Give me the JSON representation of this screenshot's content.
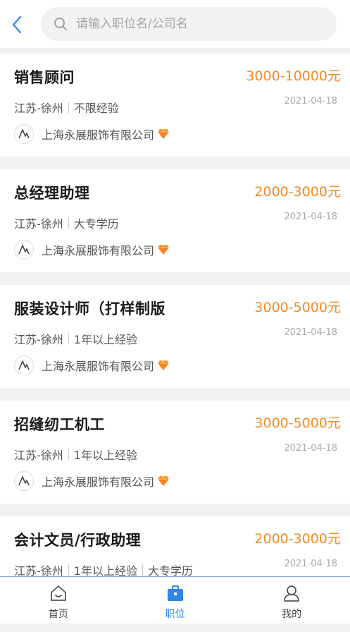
{
  "header": {
    "search_placeholder": "请输入职位名/公司名"
  },
  "jobs": [
    {
      "title": "销售顾问",
      "salary": "3000-10000元",
      "location": "江苏-徐州",
      "tags": [
        "不限经验"
      ],
      "date": "2021-04-18",
      "company": "上海永展服饰有限公司"
    },
    {
      "title": "总经理助理",
      "salary": "2000-3000元",
      "location": "江苏-徐州",
      "tags": [
        "大专学历"
      ],
      "date": "2021-04-18",
      "company": "上海永展服饰有限公司"
    },
    {
      "title": "服装设计师（打样制版",
      "salary": "3000-5000元",
      "location": "江苏-徐州",
      "tags": [
        "1年以上经验"
      ],
      "date": "2021-04-18",
      "company": "上海永展服饰有限公司"
    },
    {
      "title": "招缝纫工机工",
      "salary": "3000-5000元",
      "location": "江苏-徐州",
      "tags": [
        "1年以上经验"
      ],
      "date": "2021-04-18",
      "company": "上海永展服饰有限公司"
    },
    {
      "title": "会计文员/行政助理",
      "salary": "2000-3000元",
      "location": "江苏-徐州",
      "tags": [
        "1年以上经验",
        "大专学历"
      ],
      "date": "2021-04-18",
      "company": "上海永展服饰有限公司"
    }
  ],
  "tabbar": {
    "home": "首页",
    "jobs": "职位",
    "mine": "我的"
  },
  "colors": {
    "accent": "#2f86e8",
    "salary": "#f58a1f"
  }
}
